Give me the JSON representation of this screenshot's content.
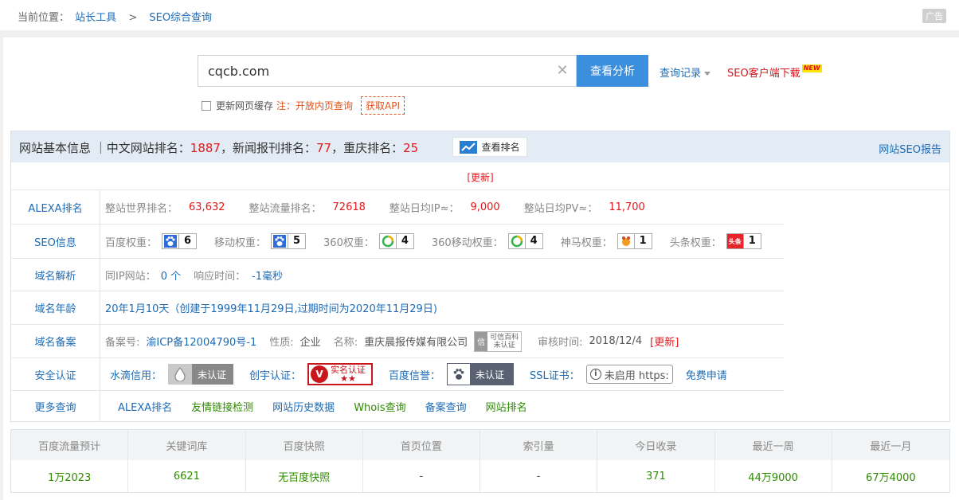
{
  "breadcrumb": {
    "prefix": "当前位置：",
    "items": [
      "站长工具",
      "SEO综合查询"
    ],
    "separator": ">"
  },
  "ad_label": "广告",
  "search": {
    "value": "cqcb.com",
    "clear_icon": "close-icon",
    "button": "查看分析",
    "history": "查询记录",
    "client": "SEO客户端下载",
    "new_badge": "NEW"
  },
  "options": {
    "cache_label": "更新网页缓存",
    "note": "注：开放内页查询",
    "api": "获取API"
  },
  "header": {
    "title_prefix": "网站基本信息 ｜中文网站排名：",
    "cn_rank": "1887",
    "news_prefix": "，新闻报刊排名：",
    "news_rank": "77",
    "city_prefix": "，重庆排名：",
    "city_rank": "25",
    "rank_button": "查看排名",
    "report_link": "网站SEO报告"
  },
  "update_link": "[更新]",
  "alexa": {
    "label": "ALEXA排名",
    "items": [
      {
        "key": "整站世界排名：",
        "value": "63,632"
      },
      {
        "key": "整站流量排名：",
        "value": "72618"
      },
      {
        "key": "整站日均IP≈：",
        "value": "9,000"
      },
      {
        "key": "整站日均PV≈：",
        "value": "11,700"
      }
    ]
  },
  "seo": {
    "label": "SEO信息",
    "items": [
      {
        "key": "百度权重：",
        "value": "6",
        "icon": "baidu-paw-icon"
      },
      {
        "key": "移动权重：",
        "value": "5",
        "icon": "baidu-paw-icon"
      },
      {
        "key": "360权重：",
        "value": "4",
        "icon": "360-icon"
      },
      {
        "key": "360移动权重：",
        "value": "4",
        "icon": "360-icon"
      },
      {
        "key": "神马权重：",
        "value": "1",
        "icon": "shenma-icon"
      },
      {
        "key": "头条权重：",
        "value": "1",
        "icon": "toutiao-icon"
      }
    ],
    "toutiao_icon_text": "头条"
  },
  "dns": {
    "label": "域名解析",
    "same_ip_key": "同IP网站：",
    "same_ip_value": "0 个",
    "response_key": "响应时间：",
    "response_value": "-1毫秒"
  },
  "age": {
    "label": "域名年龄",
    "value": "20年1月10天（创建于1999年11月29日,过期时间为2020年11月29日)"
  },
  "icp": {
    "label": "域名备案",
    "no_key": "备案号:",
    "no_value": "渝ICP备12004790号-1",
    "type_key": "性质:",
    "type_value": "企业",
    "name_key": "名称:",
    "name_value": "重庆晨报传媒有限公司",
    "xinyong_icon_text": "信",
    "xinyong_line1": "可信百科",
    "xinyong_line2": "未认证",
    "audit_key": "审核时间:",
    "audit_value": "2018/12/4",
    "update": "[更新]"
  },
  "security": {
    "label": "安全认证",
    "shuidi_key": "水滴信用：",
    "shuidi_badge": "未认证",
    "chuangyu_key": "创宇认证：",
    "chuangyu_line1": "实名认证",
    "chuangyu_line2": "★★",
    "chuangyu_icon_text": "V",
    "baidu_key": "百度信誉：",
    "baidu_badge": "未认证",
    "ssl_key": "SSL证书：",
    "ssl_icon_text": "i",
    "ssl_badge": "未启用 https:",
    "free_apply": "免费申请"
  },
  "more": {
    "label": "更多查询",
    "links": [
      "ALEXA排名",
      "友情链接检测",
      "网站历史数据",
      "Whois查询",
      "备案查询",
      "网站排名"
    ]
  },
  "traffic": {
    "headers": [
      "百度流量预计",
      "关键词库",
      "百度快照",
      "首页位置",
      "索引量",
      "今日收录",
      "最近一周",
      "最近一月"
    ],
    "values": [
      "1万2023",
      "6621",
      "无百度快照",
      "-",
      "-",
      "371",
      "44万9000",
      "67万4000"
    ]
  },
  "colors": {
    "accent": "#3c8fdc",
    "link": "#1d6bb5",
    "red": "#e4171b",
    "green": "#2e8b00",
    "header_bg": "#e3ebf4"
  }
}
